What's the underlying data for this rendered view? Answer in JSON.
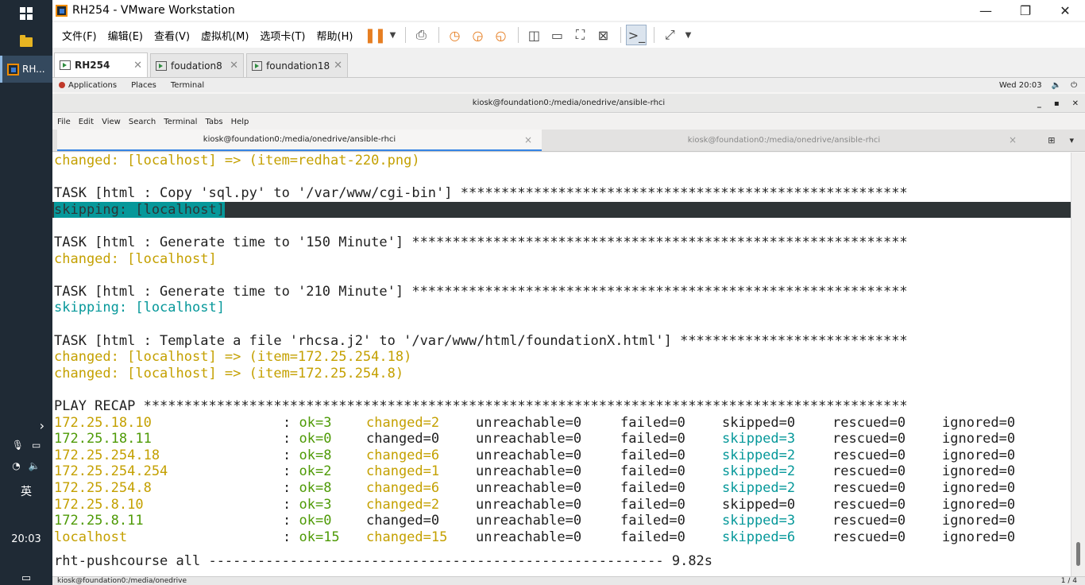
{
  "taskbar": {
    "vm_item_label": "RH...",
    "ime": "英",
    "clock": "20:03",
    "chevron": "›"
  },
  "window": {
    "title": "RH254 - VMware Workstation",
    "minimize": "—",
    "maximize": "❐",
    "close": "✕"
  },
  "menu": [
    "文件(F)",
    "编辑(E)",
    "查看(V)",
    "虚拟机(M)",
    "选项卡(T)",
    "帮助(H)"
  ],
  "vm_tabs": [
    {
      "label": "RH254",
      "active": true
    },
    {
      "label": "foudation8",
      "active": false
    },
    {
      "label": "foundation18",
      "active": false
    }
  ],
  "gnome": {
    "applications": "Applications",
    "places": "Places",
    "terminal": "Terminal",
    "datetime": "Wed 20:03"
  },
  "terminal_window": {
    "title": "kiosk@foundation0:/media/onedrive/ansible-rhci",
    "menu": [
      "File",
      "Edit",
      "View",
      "Search",
      "Terminal",
      "Tabs",
      "Help"
    ],
    "tab_active": "kiosk@foundation0:/media/onedrive/ansible-rhci",
    "tab_inactive": "kiosk@foundation0:/media/onedrive/ansible-rhci"
  },
  "output": {
    "l1": "changed: [localhost] => (item=redhat-220.png)",
    "l2": "TASK [html : Copy 'sql.py' to '/var/www/cgi-bin'] *******************************************************",
    "l3": "skipping: [localhost]",
    "l4": "TASK [html : Generate time to '150 Minute'] *************************************************************",
    "l5": "changed: [localhost]",
    "l6": "TASK [html : Generate time to '210 Minute'] *************************************************************",
    "l7": "skipping: [localhost]",
    "l8": "TASK [html : Template a file 'rhcsa.j2' to '/var/www/html/foundationX.html'] ****************************",
    "l9": "changed: [localhost] => (item=172.25.254.18)",
    "l10": "changed: [localhost] => (item=172.25.254.8)",
    "l11": "PLAY RECAP **********************************************************************************************",
    "last": "rht-pushcourse all -------------------------------------------------------- 9.82s"
  },
  "recap": [
    {
      "host": "172.25.18.10",
      "ok": "ok=3",
      "changed": "changed=2",
      "unreachable": "unreachable=0",
      "failed": "failed=0",
      "skipped": "skipped=0",
      "rescued": "rescued=0",
      "ignored": "ignored=0"
    },
    {
      "host": "172.25.18.11",
      "ok": "ok=0",
      "changed": "changed=0",
      "unreachable": "unreachable=0",
      "failed": "failed=0",
      "skipped": "skipped=3",
      "rescued": "rescued=0",
      "ignored": "ignored=0"
    },
    {
      "host": "172.25.254.18",
      "ok": "ok=8",
      "changed": "changed=6",
      "unreachable": "unreachable=0",
      "failed": "failed=0",
      "skipped": "skipped=2",
      "rescued": "rescued=0",
      "ignored": "ignored=0"
    },
    {
      "host": "172.25.254.254",
      "ok": "ok=2",
      "changed": "changed=1",
      "unreachable": "unreachable=0",
      "failed": "failed=0",
      "skipped": "skipped=2",
      "rescued": "rescued=0",
      "ignored": "ignored=0"
    },
    {
      "host": "172.25.254.8",
      "ok": "ok=8",
      "changed": "changed=6",
      "unreachable": "unreachable=0",
      "failed": "failed=0",
      "skipped": "skipped=2",
      "rescued": "rescued=0",
      "ignored": "ignored=0"
    },
    {
      "host": "172.25.8.10",
      "ok": "ok=3",
      "changed": "changed=2",
      "unreachable": "unreachable=0",
      "failed": "failed=0",
      "skipped": "skipped=0",
      "rescued": "rescued=0",
      "ignored": "ignored=0"
    },
    {
      "host": "172.25.8.11",
      "ok": "ok=0",
      "changed": "changed=0",
      "unreachable": "unreachable=0",
      "failed": "failed=0",
      "skipped": "skipped=3",
      "rescued": "rescued=0",
      "ignored": "ignored=0"
    },
    {
      "host": "localhost",
      "ok": "ok=15",
      "changed": "changed=15",
      "unreachable": "unreachable=0",
      "failed": "failed=0",
      "skipped": "skipped=6",
      "rescued": "rescued=0",
      "ignored": "ignored=0"
    }
  ],
  "guest_bottom": {
    "task": "kiosk@foundation0:/media/onedrive",
    "pager": "1 / 4"
  },
  "colors": {
    "yellow": "#c4a000",
    "cyan": "#06989a",
    "green": "#4e9a06"
  }
}
